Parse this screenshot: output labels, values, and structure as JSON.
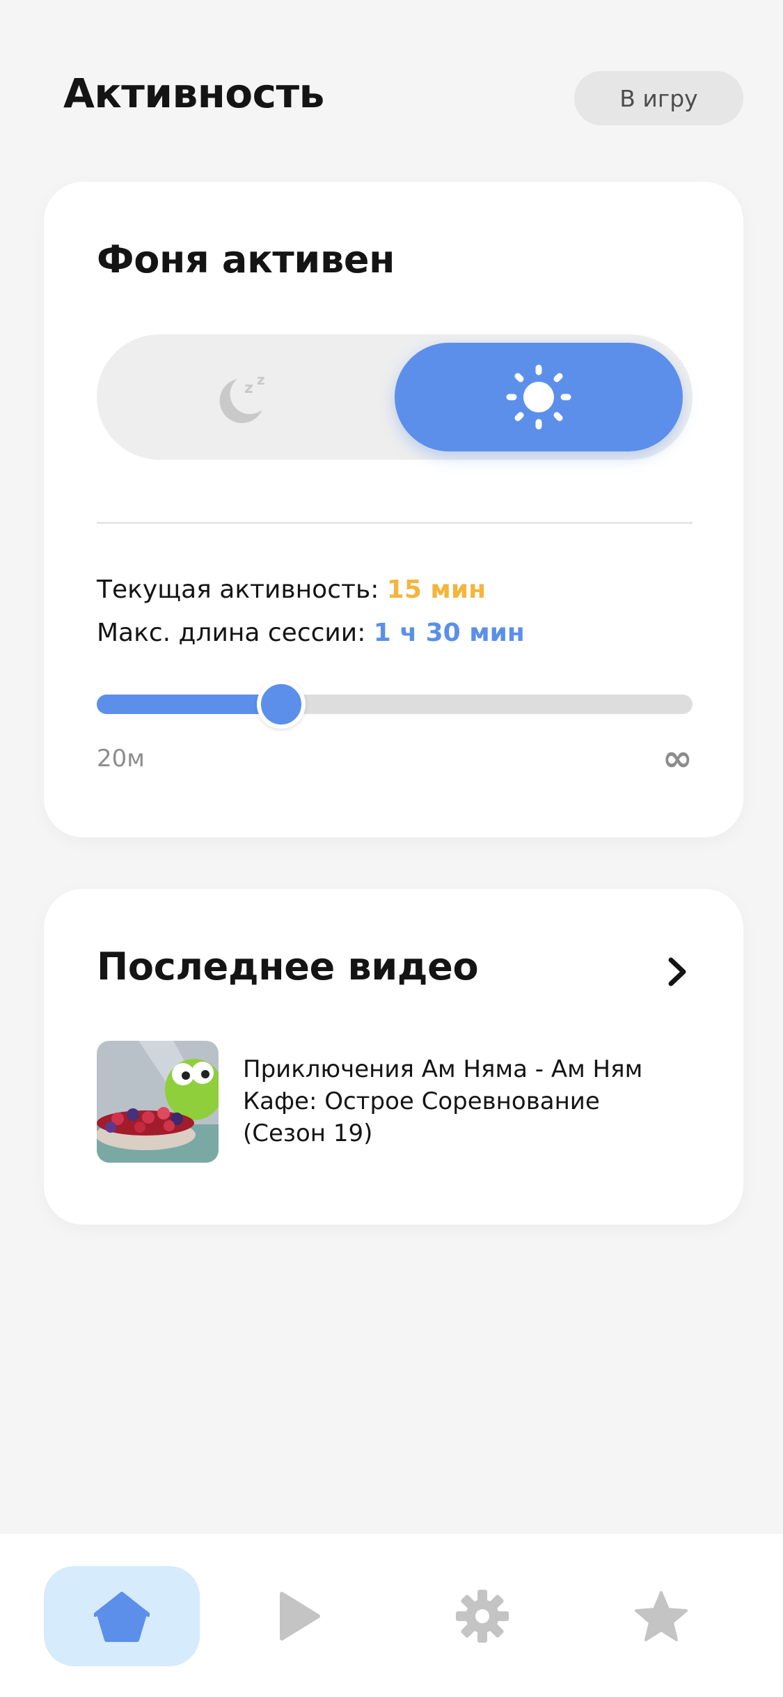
{
  "header": {
    "title": "Активность",
    "to_game_label": "В игру"
  },
  "activity": {
    "title": "Фоня активен",
    "mode": {
      "options": [
        "sleep",
        "active"
      ],
      "selected": "active",
      "sleep_icon": "moon-zzz-icon",
      "active_icon": "sun-icon"
    },
    "current_label": "Текущая активность:",
    "current_value": "15 мин",
    "max_session_label": "Макс. длина сессии:",
    "max_session_value": "1 ч 30 мин",
    "slider": {
      "min_label": "20м",
      "max_label": "∞",
      "fraction": 0.31
    }
  },
  "last_video": {
    "title": "Последнее видео",
    "chevron_icon": "chevron-right-icon",
    "item": {
      "title": "Приключения Ам Няма - Ам Ням Кафе: Острое Соревнование (Сезон 19)",
      "thumbnail": "om-nom-berry-bowl-thumbnail"
    }
  },
  "bottom_nav": {
    "items": [
      {
        "id": "home",
        "icon": "home-icon",
        "active": true
      },
      {
        "id": "play",
        "icon": "play-icon",
        "active": false
      },
      {
        "id": "settings",
        "icon": "gear-icon",
        "active": false
      },
      {
        "id": "favorites",
        "icon": "star-icon",
        "active": false
      }
    ]
  },
  "colors": {
    "accent": "#5b8fea",
    "highlight_orange": "#f5b43c",
    "background": "#f5f5f5",
    "nav_active_bg": "#d6ebfb",
    "muted": "#8c8c8c"
  }
}
